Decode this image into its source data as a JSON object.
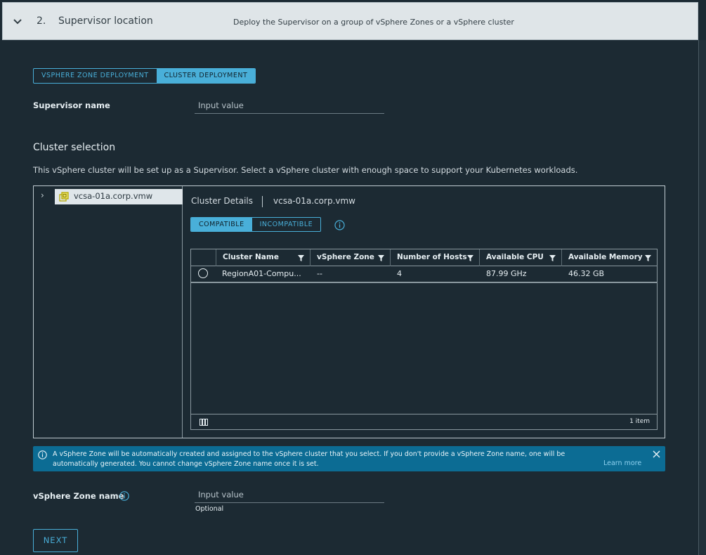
{
  "step": {
    "number": "2.",
    "title": "Supervisor location",
    "description": "Deploy the Supervisor on a group of vSphere Zones or a vSphere cluster"
  },
  "deployment_tabs": [
    "VSPHERE ZONE DEPLOYMENT",
    "CLUSTER DEPLOYMENT"
  ],
  "deployment_active": "CLUSTER DEPLOYMENT",
  "supervisor_name": {
    "label": "Supervisor name",
    "placeholder": "Input value"
  },
  "cluster_selection": {
    "title": "Cluster selection",
    "description": "This vSphere cluster will be set up as a Supervisor. Select a vSphere cluster with enough space to support your Kubernetes workloads."
  },
  "tree": {
    "node_label": "vcsa-01a.corp.vmw",
    "icon": "vcenter-icon"
  },
  "details": {
    "title": "Cluster Details",
    "host": "vcsa-01a.corp.vmw",
    "tabs": [
      "COMPATIBLE",
      "INCOMPATIBLE"
    ],
    "active_tab": "COMPATIBLE"
  },
  "grid": {
    "columns": [
      "Cluster Name",
      "vSphere Zone",
      "Number of Hosts",
      "Available CPU",
      "Available Memory"
    ],
    "rows": [
      [
        "RegionA01-Compu...",
        "--",
        "4",
        "87.99 GHz",
        "46.32 GB"
      ]
    ],
    "count": "1 item"
  },
  "alert": {
    "text": "A vSphere Zone will be automatically created and assigned to the vSphere cluster that you select. If you don't provide a vSphere Zone name, one will be automatically generated. You cannot change vSphere Zone name once it is set.",
    "link": "Learn more"
  },
  "zone_name": {
    "label": "vSphere Zone name",
    "placeholder": "Input value",
    "helper": "Optional"
  },
  "next_label": "NEXT",
  "colors": {
    "accent": "#49afd9",
    "background": "#1c2a33",
    "alert": "#0c6c94"
  }
}
